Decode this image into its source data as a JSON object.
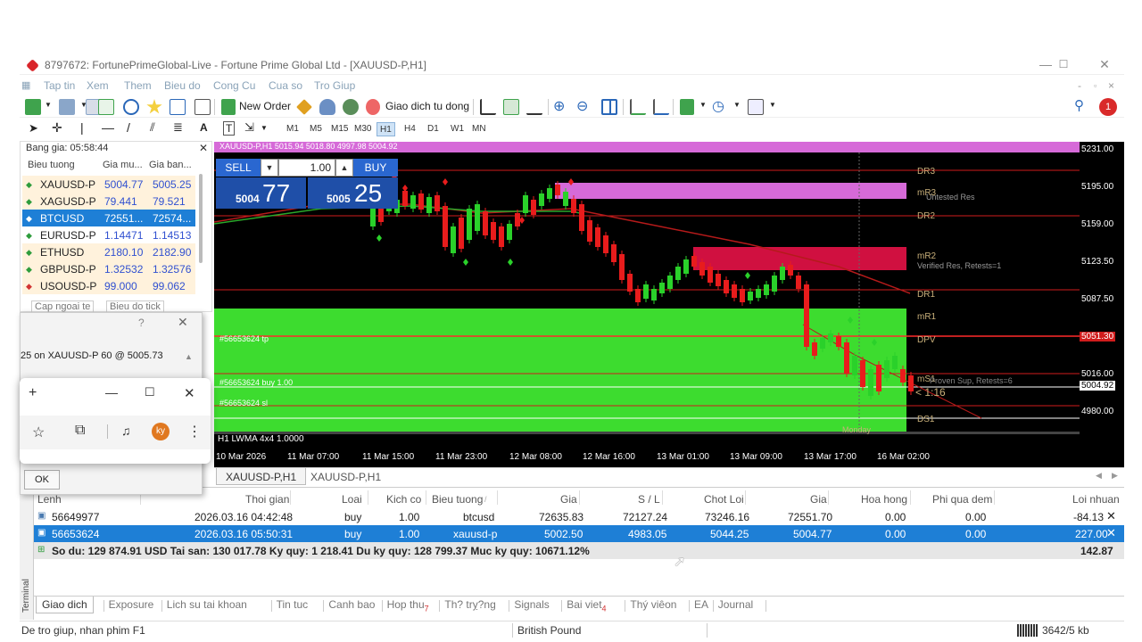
{
  "window": {
    "title": "8797672: FortunePrimeGlobal-Live - Fortune Prime Global Ltd - [XAUUSD-P,H1]",
    "menu": [
      "Tap tin",
      "Xem",
      "Them",
      "Bieu do",
      "Cong Cu",
      "Cua so",
      "Tro Giup"
    ]
  },
  "toolbar": {
    "new_order": "New Order",
    "auto_trading": "Giao dich tu dong",
    "timeframes": [
      "M1",
      "M5",
      "M15",
      "M30",
      "H1",
      "H4",
      "D1",
      "W1",
      "MN"
    ],
    "active_timeframe": "H1",
    "text_tool": "A",
    "label_tool": "T"
  },
  "market_watch": {
    "title": "Bang gia: 05:58:44",
    "columns": [
      "Bieu tuong",
      "Gia mu...",
      "Gia ban..."
    ],
    "rows": [
      {
        "symbol": "XAUUSD-P",
        "bid": "5004.77",
        "ask": "5005.25",
        "dir": "up"
      },
      {
        "symbol": "XAGUSD-P",
        "bid": "79.441",
        "ask": "79.521",
        "dir": "up"
      },
      {
        "symbol": "BTCUSD",
        "bid": "72551...",
        "ask": "72574...",
        "dir": "down"
      },
      {
        "symbol": "EURUSD-P",
        "bid": "1.14471",
        "ask": "1.14513",
        "dir": "up"
      },
      {
        "symbol": "ETHUSD",
        "bid": "2180.10",
        "ask": "2182.90",
        "dir": "up"
      },
      {
        "symbol": "GBPUSD-P",
        "bid": "1.32532",
        "ask": "1.32576",
        "dir": "up"
      },
      {
        "symbol": "USOUSD-P",
        "bid": "99.000",
        "ask": "99.062",
        "dir": "down"
      }
    ],
    "tabs": [
      "Cap ngoai te",
      "Bieu do tick"
    ]
  },
  "dialog": {
    "help": "?",
    "message": "25 on XAUUSD-P 60 @ 5005.73",
    "ok": "OK"
  },
  "browser_popup": {
    "new_tab": "+",
    "avatar": "ky"
  },
  "chart": {
    "header": "XAUUSD-P,H1  5015.94 5018.80 4997.98 5004.92",
    "trade_panel": {
      "sell": "SELL",
      "buy": "BUY",
      "volume": "1.00",
      "sell_price_small": "5004",
      "sell_price_big": "77",
      "buy_price_small": "5005",
      "buy_price_big": "25"
    },
    "indicator_label": "H1 LWMA 4x4  1.0000",
    "order_labels": {
      "tp": "#56653624 tp",
      "buy": "#56653624 buy 1.00",
      "sl": "#56653624 sl"
    },
    "level_labels": {
      "dr3": "DR3",
      "mr3": "mR3",
      "untested_res": "Untested Res",
      "dr2": "DR2",
      "mr2": "mR2",
      "verified_res": "Verified Res, Retests=1",
      "dr1": "DR1",
      "mr1": "mR1",
      "dpv": "DPV",
      "ms1": "mS1",
      "sup_text": "Proven Sup, Retests=6",
      "countdown": "< 1:16",
      "ds1": "DS1",
      "day": "Monday"
    },
    "price_ticks": [
      "5231.00",
      "5195.00",
      "5159.00",
      "5123.50",
      "5087.50",
      "5016.00",
      "4980.00"
    ],
    "current_price_tag": "5004.92",
    "red_price_tag": "5051.30",
    "time_ticks": [
      "10 Mar 2026",
      "11 Mar 07:00",
      "11 Mar 15:00",
      "11 Mar 23:00",
      "12 Mar 08:00",
      "12 Mar 16:00",
      "13 Mar 01:00",
      "13 Mar 09:00",
      "13 Mar 17:00",
      "16 Mar 02:00"
    ],
    "tabs": [
      "XAUUSD-P,H1",
      "XAUUSD-P,H1"
    ]
  },
  "terminal": {
    "side_label": "Terminal",
    "columns": [
      "Lenh",
      "Thoi gian",
      "Loai",
      "Kich co",
      "Bieu tuong",
      "Gia",
      "S / L",
      "Chot Loi",
      "Gia",
      "Hoa hong",
      "Phi qua dem",
      "Loi nhuan"
    ],
    "rows": [
      {
        "order": "56649977",
        "time": "2026.03.16 04:42:48",
        "type": "buy",
        "size": "1.00",
        "symbol": "btcusd",
        "price": "72635.83",
        "sl": "72127.24",
        "tp": "73246.16",
        "cur": "72551.70",
        "comm": "0.00",
        "swap": "0.00",
        "profit": "-84.13"
      },
      {
        "order": "56653624",
        "time": "2026.03.16 05:50:31",
        "type": "buy",
        "size": "1.00",
        "symbol": "xauusd-p",
        "price": "5002.50",
        "sl": "4983.05",
        "tp": "5044.25",
        "cur": "5004.77",
        "comm": "0.00",
        "swap": "0.00",
        "profit": "227.00"
      }
    ],
    "summary": "So du: 129 874.91 USD  Tai san: 130 017.78  Ky quy: 1 218.41  Du ky quy: 128 799.37  Muc ky quy: 10671.12%",
    "summary_profit": "142.87",
    "tabs": [
      {
        "label": "Giao dich",
        "badge": ""
      },
      {
        "label": "Exposure",
        "badge": ""
      },
      {
        "label": "Lich su tai khoan",
        "badge": ""
      },
      {
        "label": "Tin tuc",
        "badge": ""
      },
      {
        "label": "Canh bao",
        "badge": ""
      },
      {
        "label": "Hop thu",
        "badge": "7"
      },
      {
        "label": "Th? trỵ?ng",
        "badge": ""
      },
      {
        "label": "Signals",
        "badge": ""
      },
      {
        "label": "Bai viet",
        "badge": "4"
      },
      {
        "label": "Thý viêon",
        "badge": ""
      },
      {
        "label": "EA",
        "badge": ""
      },
      {
        "label": "Journal",
        "badge": ""
      }
    ]
  },
  "status": {
    "help": "De tro giup, nhan phim F1",
    "profile": "British Pound",
    "traffic": "3642/5 kb"
  },
  "colors": {
    "up": "#2e9c3c",
    "down": "#d23232",
    "selection": "#1e7fd6",
    "zone_green": "#3ddc2f",
    "zone_magenta": "#d66ad8",
    "zone_red": "#d01040"
  }
}
